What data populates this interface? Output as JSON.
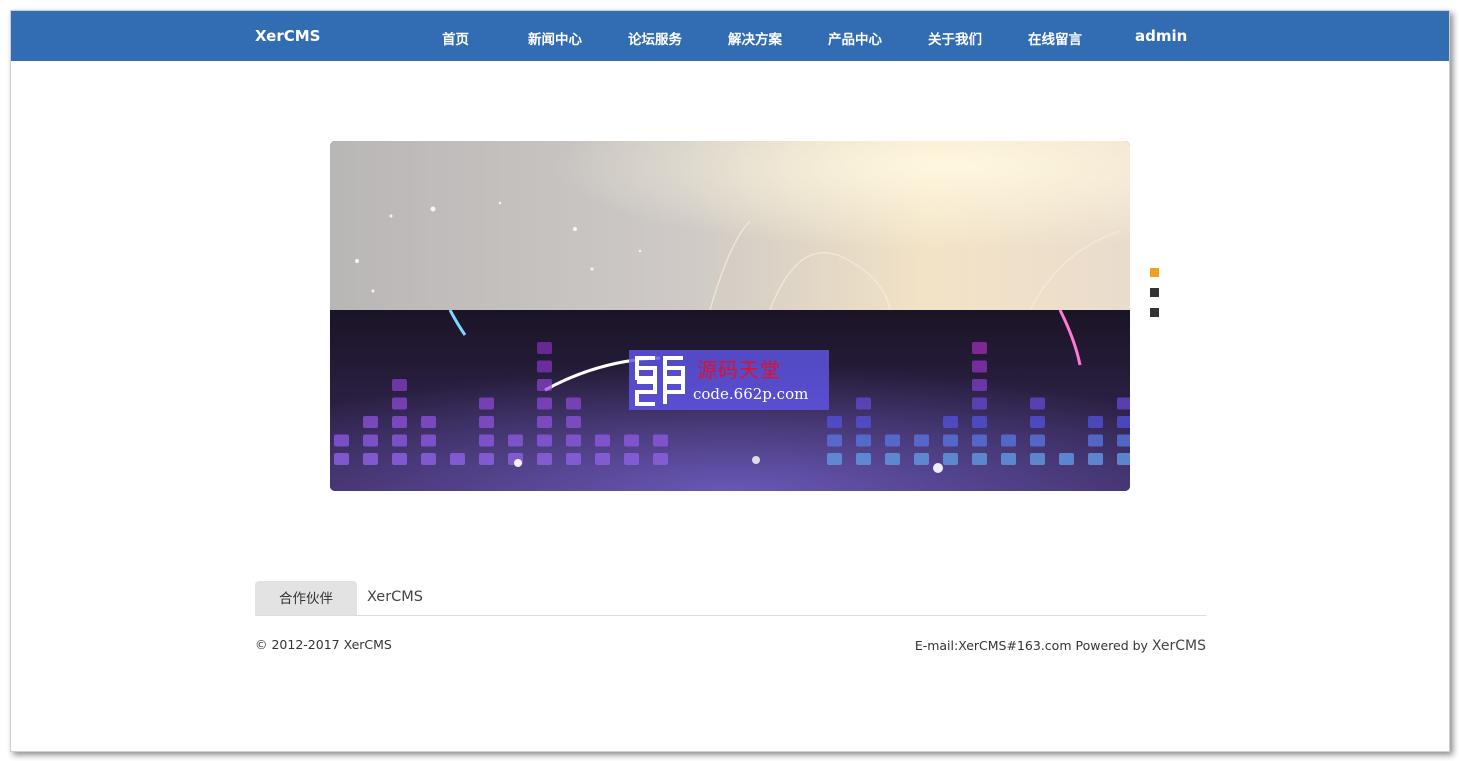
{
  "navbar": {
    "brand": "XerCMS",
    "items": [
      {
        "label": "首页"
      },
      {
        "label": "新闻中心"
      },
      {
        "label": "论坛服务"
      },
      {
        "label": "解决方案"
      },
      {
        "label": "产品中心"
      },
      {
        "label": "关于我们"
      },
      {
        "label": "在线留言"
      },
      {
        "label": "admin"
      }
    ],
    "color": "#326cb3"
  },
  "carousel": {
    "slide_count": 3,
    "active_index": 0,
    "active_dot_color": "#f0a020",
    "dot_color": "#333333",
    "watermark": {
      "logo_text": "662P",
      "title": "源码天堂",
      "url": "code.662p.com"
    }
  },
  "partners": {
    "label": "合作伙伴",
    "links": [
      {
        "label": "XerCMS"
      }
    ]
  },
  "footer": {
    "copyright": "© 2012-2017 XerCMS",
    "email_text": "E-mail:XerCMS#163.com",
    "powered_by": "Powered by",
    "powered_link": "XerCMS"
  }
}
